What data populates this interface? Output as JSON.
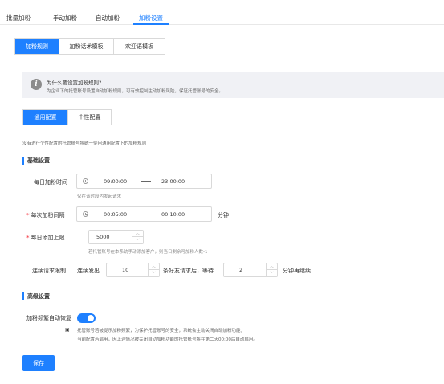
{
  "top_tabs": [
    "批量加粉",
    "手动加粉",
    "自动加粉",
    "加粉设置"
  ],
  "sub_tabs": [
    "加粉规则",
    "加粉话术模板",
    "欢迎语模板"
  ],
  "notice": {
    "title": "为什么要设置加粉规则?",
    "text": "为企业下的托管账号设置自动加粉规则，可有效控制主动加粉风险，保证托管账号的安全。"
  },
  "config_tabs": [
    "通用配置",
    "个性配置"
  ],
  "hint": "没有进行个性配置的托管账号将统一使用通用配置下的加粉规则",
  "basic": {
    "title": "基础设置",
    "daily_time": {
      "label": "每日加粉时间",
      "start": "09:00:00",
      "sep": "—",
      "end": "23:00:00",
      "help": "仅在该时段内发起请求"
    },
    "interval": {
      "label": "每次加粉间隔",
      "start": "00:05:00",
      "sep": "—",
      "end": "00:10:00",
      "unit": "分钟"
    },
    "daily_limit": {
      "label": "每日添加上限",
      "value": "5000",
      "help": "若托管账号在本系统手动添加客户，则当日剩余可加粉人数-1"
    },
    "continuous": {
      "label": "连续请求限制",
      "prefix": "连续发出",
      "count": "10",
      "middle": "条好友请求后，等待",
      "wait": "2",
      "suffix": "分钟再继续"
    }
  },
  "advanced": {
    "title": "高级设置",
    "auto_recover": {
      "label": "加粉频繁自动恢复",
      "enabled": true,
      "note1": "托管账号若被提示加粉频繁，为保护托管账号的安全，系统会主动关闭自动加粉功能；",
      "note2": "当前配置若启用，因上述情况被关闭自动加粉功能的托管账号将在第二天00:00后自动启用。"
    }
  },
  "save_label": "保存",
  "colors": {
    "accent": "#1e80ff",
    "required": "#f5222d"
  }
}
